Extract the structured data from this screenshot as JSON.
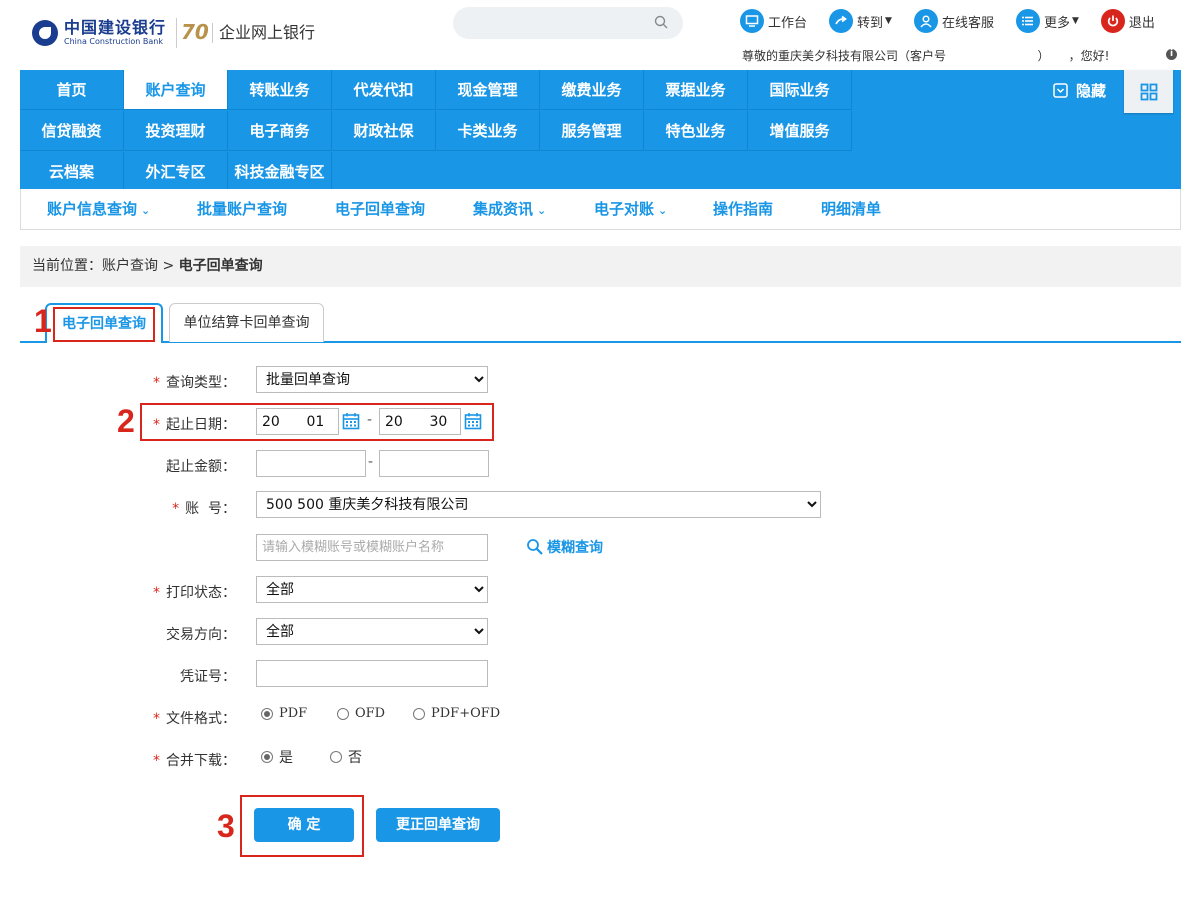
{
  "header": {
    "bank_name_cn": "中国建设银行",
    "bank_name_en": "China Construction Bank",
    "anniversary_badge": "70",
    "portal_title": "企业网上银行",
    "search_placeholder": "",
    "tools": [
      {
        "label": "工作台",
        "icon": "desktop-icon",
        "color": "#1a96e6"
      },
      {
        "label": "转到",
        "icon": "arrow-forward-icon",
        "color": "#1a96e6"
      },
      {
        "label": "在线客服",
        "icon": "user-service-icon",
        "color": "#1a96e6"
      },
      {
        "label": "更多",
        "icon": "list-icon",
        "color": "#1a96e6"
      },
      {
        "label": "退出",
        "icon": "power-icon",
        "color": "#d9261c"
      }
    ],
    "welcome_text": "尊敬的重庆美夕科技有限公司（客户号                        ）     ，您好!",
    "info_icon": "i"
  },
  "nav": {
    "rows": [
      [
        "首页",
        "账户查询",
        "转账业务",
        "代发代扣",
        "现金管理",
        "缴费业务",
        "票据业务",
        "国际业务"
      ],
      [
        "信贷融资",
        "投资理财",
        "电子商务",
        "财政社保",
        "卡类业务",
        "服务管理",
        "特色业务",
        "增值服务"
      ],
      [
        "云档案",
        "外汇专区",
        "科技金融专区"
      ]
    ],
    "active": "账户查询",
    "hide_label": "隐藏"
  },
  "subnav": [
    {
      "label": "账户信息查询",
      "dropdown": true
    },
    {
      "label": "批量账户查询",
      "dropdown": false
    },
    {
      "label": "电子回单查询",
      "dropdown": false
    },
    {
      "label": "集成资讯",
      "dropdown": true
    },
    {
      "label": "电子对账",
      "dropdown": true
    },
    {
      "label": "操作指南",
      "dropdown": false
    },
    {
      "label": "明细清单",
      "dropdown": false
    }
  ],
  "breadcrumb": {
    "prefix": "当前位置：账户查询 ",
    "sep": ">",
    "current": "电子回单查询"
  },
  "tabs": [
    {
      "label": "电子回单查询",
      "active": true
    },
    {
      "label": "单位结算卡回单查询",
      "active": false
    }
  ],
  "annotations": [
    "1",
    "2",
    "3"
  ],
  "form": {
    "query_type": {
      "label": "查询类型：",
      "value": "批量回单查询",
      "required": true
    },
    "date_range": {
      "label": "起止日期：",
      "start": "20      01",
      "end": "20      30",
      "required": true,
      "sep": "-"
    },
    "amount_range": {
      "label": "起止金额：",
      "min": "",
      "max": "",
      "required": false,
      "sep": "-"
    },
    "account": {
      "label": "账  号：",
      "value": "500                              500 重庆美夕科技有限公司",
      "required": true
    },
    "fuzzy_search": {
      "placeholder": "请输入模糊账号或模糊账户名称",
      "link": "模糊查询"
    },
    "print_status": {
      "label": "打印状态：",
      "value": "全部",
      "required": true
    },
    "direction": {
      "label": "交易方向：",
      "value": "全部",
      "required": false
    },
    "voucher": {
      "label": "凭证号：",
      "value": "",
      "required": false
    },
    "file_format": {
      "label": "文件格式：",
      "options": [
        "PDF",
        "OFD",
        "PDF+OFD"
      ],
      "selected": "PDF",
      "required": true
    },
    "merge": {
      "label": "合并下载：",
      "options": [
        "是",
        "否"
      ],
      "selected": "是",
      "required": true
    },
    "required_mark": "*"
  },
  "buttons": {
    "confirm": "确 定",
    "correct": "更正回单查询"
  }
}
